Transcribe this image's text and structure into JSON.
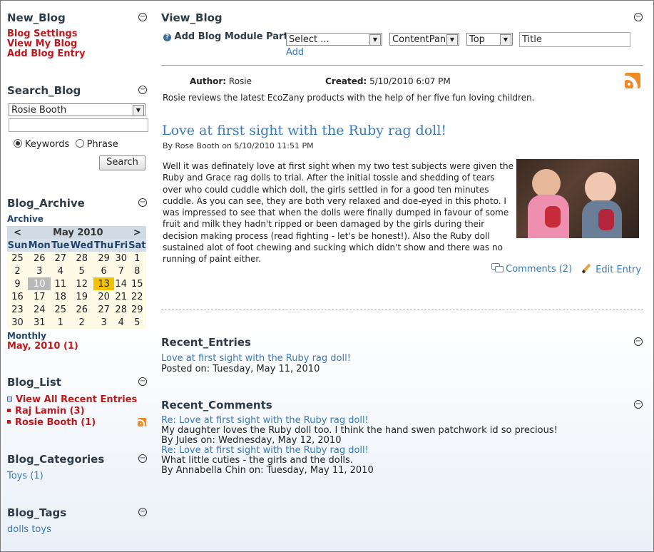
{
  "new_blog": {
    "title": "New_Blog",
    "links": [
      "Blog Settings",
      "View My Blog",
      "Add Blog Entry"
    ]
  },
  "search_blog": {
    "title": "Search_Blog",
    "blog_select": "Rosie Booth",
    "query": "",
    "option_keywords": "Keywords",
    "option_phrase": "Phrase",
    "button": "Search"
  },
  "archive": {
    "title": "Blog_Archive",
    "subtitle": "Archive",
    "month": "May 2010",
    "prev": "<",
    "next": ">",
    "weekdays": [
      "Sun",
      "Mon",
      "Tue",
      "Wed",
      "Thu",
      "Fri",
      "Sat"
    ],
    "weeks": [
      [
        "25",
        "26",
        "27",
        "28",
        "29",
        "30",
        "1"
      ],
      [
        "2",
        "3",
        "4",
        "5",
        "6",
        "7",
        "8"
      ],
      [
        "9",
        "10",
        "11",
        "12",
        "13",
        "14",
        "15"
      ],
      [
        "16",
        "17",
        "18",
        "19",
        "20",
        "21",
        "22"
      ],
      [
        "23",
        "24",
        "25",
        "26",
        "27",
        "28",
        "29"
      ],
      [
        "30",
        "31",
        "1",
        "2",
        "3",
        "4",
        "5"
      ]
    ],
    "monthly_label": "Monthly",
    "monthly_link": "May, 2010 (1)"
  },
  "blog_list": {
    "title": "Blog_List",
    "items": [
      "View All Recent Entries",
      "Raj Lamin (3)",
      "Rosie Booth (1)"
    ]
  },
  "categories": {
    "title": "Blog_Categories",
    "items": [
      "Toys (1)"
    ]
  },
  "tags": {
    "title": "Blog_Tags",
    "text": "dolls toys"
  },
  "view_blog": {
    "title": "View_Blog",
    "add_module_label": "Add Blog Module Part",
    "module_select": "Select ...",
    "pane_select": "ContentPane",
    "position_select": "Top",
    "title_input": "Title",
    "add_link": "Add",
    "author_label": "Author:",
    "author": "Rosie",
    "created_label": "Created:",
    "created": "5/10/2010 6:07 PM",
    "description": "Rosie reviews the latest EcoZany products with the help of her five fun loving children.",
    "entry": {
      "title": "Love at first sight with the Ruby rag doll!",
      "byline": "By Rose Booth on 5/10/2010 11:51 PM",
      "body": "Well it was definately love at first sight when my two test subjects were given the Ruby and Grace rag dolls to trial. After the initial tossle and shedding of tears over who could cuddle which doll, the girls settled in for a good ten minutes cuddle. As you can see, they are both very relaxed and doe-eyed in this photo. I was impressed to see that when the dolls were finally dumped in favour of some fruit and milk they hadn't ripped or been damaged by the girls during their decision making process (read fighting - let's be honest!). Also the Ruby doll sustained alot of foot chewing and sucking which didn't show and there was no running of paint either.",
      "comments": "Comments (2)",
      "edit": "Edit Entry"
    }
  },
  "recent_entries": {
    "title": "Recent_Entries",
    "items": [
      {
        "link": "Love at first sight with the Ruby rag doll!",
        "meta": "Posted on: Tuesday, May 11, 2010"
      }
    ]
  },
  "recent_comments": {
    "title": "Recent_Comments",
    "items": [
      {
        "link": "Re: Love at first sight with the Ruby rag doll!",
        "text": "My daughter loves the Ruby doll too. I think the hand swen patchwork id so precious!",
        "by": "By Jules on: Wednesday, May 12, 2010"
      },
      {
        "link": "Re: Love at first sight with the Ruby rag doll!",
        "text": "What little cuties - the girls and the dolls.",
        "by": "By Annabella Chin on: Tuesday, May 11, 2010"
      }
    ]
  },
  "colors": {
    "accent_red": "#c0191d",
    "link_blue": "#3b7ab8",
    "today": "#f2c200",
    "rss": "#f08a24"
  }
}
